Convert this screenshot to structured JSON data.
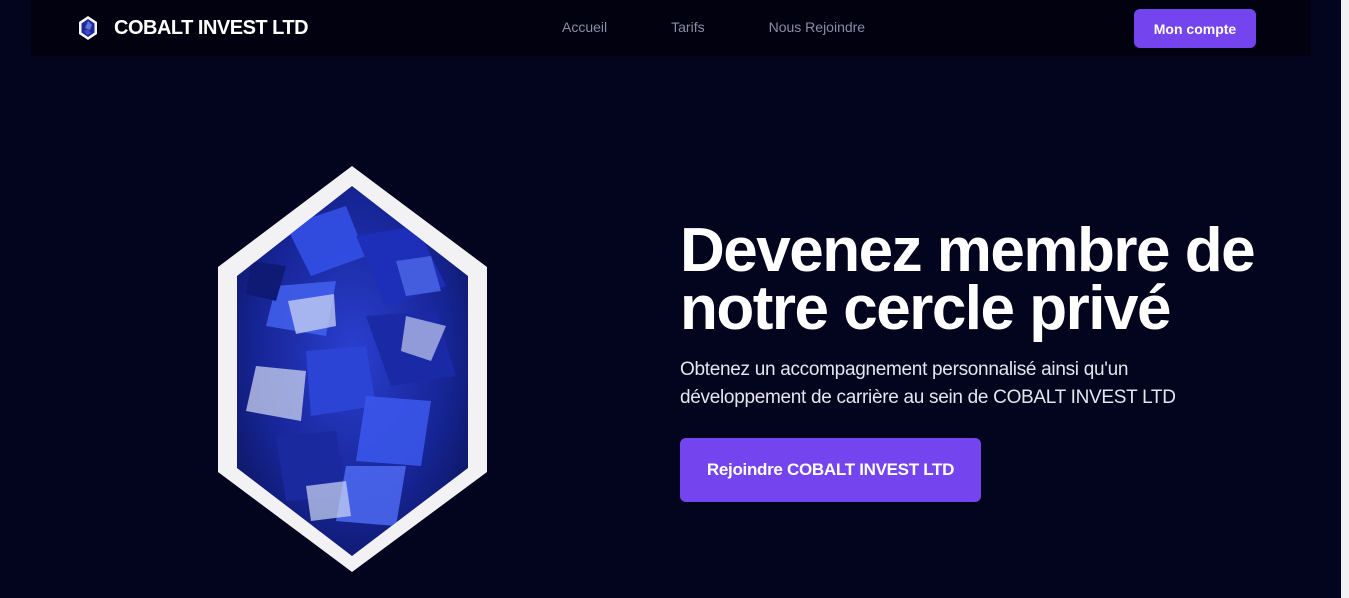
{
  "brand": {
    "name": "COBALT INVEST LTD",
    "logo_icon": "hexagon-crystal-icon"
  },
  "nav": {
    "links": [
      {
        "label": "Accueil"
      },
      {
        "label": "Tarifs"
      },
      {
        "label": "Nous Rejoindre"
      }
    ],
    "account_label": "Mon compte"
  },
  "hero": {
    "title_line1": "Devenez membre de",
    "title_line2": "notre cercle privé",
    "subtitle_line1": "Obtenez un accompagnement personnalisé ainsi qu'un",
    "subtitle_line2": "développement de carrière au sein de COBALT INVEST LTD",
    "cta_label": "Rejoindre COBALT INVEST LTD",
    "image_icon": "cobalt-crystal-hexagon-image"
  },
  "colors": {
    "background": "#03041d",
    "navbar": "#01010f",
    "accent": "#7444ee",
    "text": "#ffffff",
    "nav_text": "#8a8da6"
  }
}
